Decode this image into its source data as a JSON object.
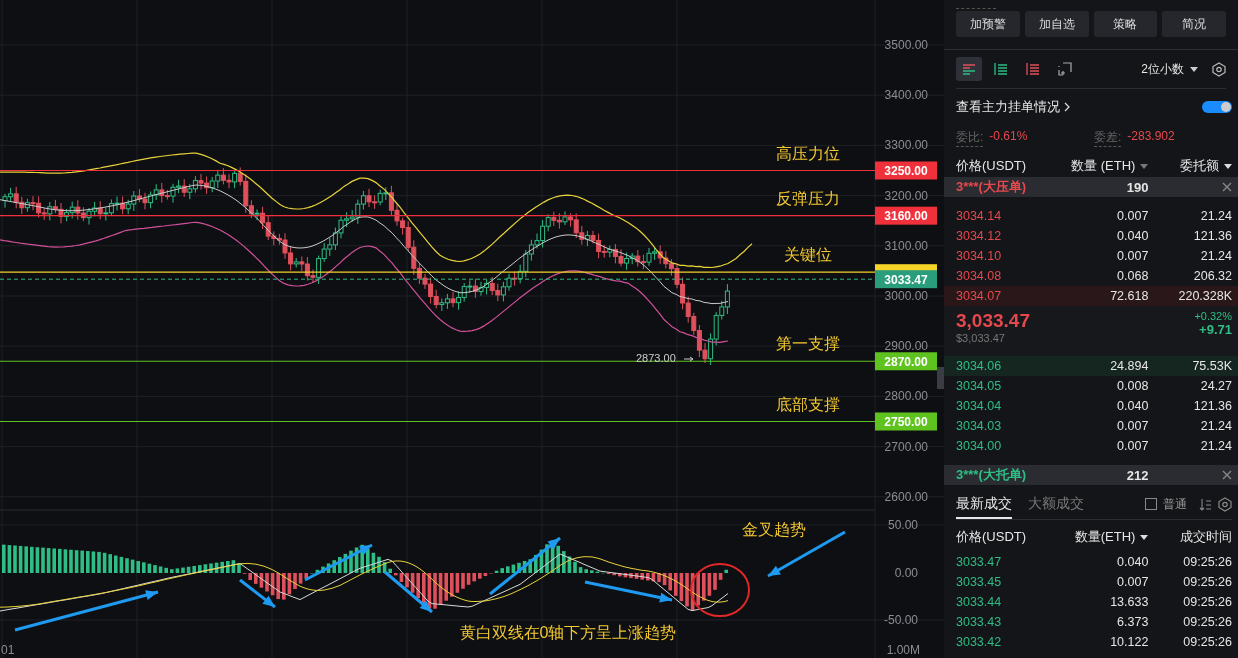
{
  "chart": {
    "price_ticks": [
      "3500.00",
      "3400.00",
      "3300.00",
      "3200.00",
      "3100.00",
      "3000.00",
      "2900.00",
      "2800.00",
      "2700.00",
      "2600.00"
    ],
    "levels": [
      {
        "price": "3250.00",
        "note": "高压力位",
        "color": "#f0313c"
      },
      {
        "price": "3160.00",
        "note": "反弹压力",
        "color": "#f0313c"
      },
      {
        "note": "关键位",
        "color": "#f5d327"
      },
      {
        "price": "2870.00",
        "note": "第一支撑",
        "color": "#5fc31f"
      },
      {
        "price": "2750.00",
        "note": "底部支撑",
        "color": "#5fc31f"
      }
    ],
    "current_price": "3033.47",
    "low_marker": "2873.00",
    "time_tick": "01"
  },
  "macd": {
    "ticks": [
      "50.00",
      "0.00",
      "-50.00"
    ],
    "volume_tick": "1.00M",
    "notes": [
      "金叉趋势",
      "黄白双线在0轴下方呈上涨趋势"
    ]
  },
  "panel": {
    "actions": [
      "加预警",
      "加自选",
      "策略",
      "简况"
    ],
    "depth_modes": [
      {
        "kind": "both",
        "selected": true
      },
      {
        "kind": "bids",
        "selected": false
      },
      {
        "kind": "asks",
        "selected": false
      },
      {
        "kind": "custom",
        "selected": false
      }
    ],
    "decimals": "2位小数",
    "main_orders": {
      "label": "查看主力挂单情况",
      "on": true
    },
    "stats": [
      {
        "label": "委比:",
        "value": "-0.61%"
      },
      {
        "label": "委差:",
        "value": "-283.902"
      }
    ],
    "book_columns": [
      {
        "label": "价格(USDT)",
        "caret": false
      },
      {
        "label": "数量 (ETH)",
        "caret": true
      },
      {
        "label": "委托额",
        "caret": true
      }
    ],
    "ask_banner": {
      "label": "3***(大压单)",
      "quantity": "190"
    },
    "asks": [
      {
        "price": "3034.14",
        "qty": "0.007",
        "amount": "21.24",
        "highlighted": false
      },
      {
        "price": "3034.12",
        "qty": "0.040",
        "amount": "121.36",
        "highlighted": false
      },
      {
        "price": "3034.10",
        "qty": "0.007",
        "amount": "21.24",
        "highlighted": false
      },
      {
        "price": "3034.08",
        "qty": "0.068",
        "amount": "206.32",
        "highlighted": false
      },
      {
        "price": "3034.07",
        "qty": "72.618",
        "amount": "220.328K",
        "highlighted": true
      }
    ],
    "last": {
      "price": "3,033.47",
      "usd": "$3,033.47",
      "change_pct": "+0.32%",
      "change": "+9.71"
    },
    "bids": [
      {
        "price": "3034.06",
        "qty": "24.894",
        "amount": "75.53K",
        "highlighted": true
      },
      {
        "price": "3034.05",
        "qty": "0.008",
        "amount": "24.27",
        "highlighted": false
      },
      {
        "price": "3034.04",
        "qty": "0.040",
        "amount": "121.36",
        "highlighted": false
      },
      {
        "price": "3034.03",
        "qty": "0.007",
        "amount": "21.24",
        "highlighted": false
      },
      {
        "price": "3034.00",
        "qty": "0.007",
        "amount": "21.24",
        "highlighted": false
      }
    ],
    "bid_banner": {
      "label": "3***(大托单)",
      "quantity": "212"
    },
    "trade_tabs": [
      {
        "label": "最新成交",
        "selected": true
      },
      {
        "label": "大额成交",
        "selected": false
      }
    ],
    "normal_filter": {
      "label": "普通",
      "checked": false
    },
    "trade_columns": [
      {
        "label": "价格(USDT)",
        "caret": false
      },
      {
        "label": "数量(ETH)",
        "caret": true
      },
      {
        "label": "成交时间",
        "caret": false
      }
    ],
    "trades": [
      {
        "price": "3033.47",
        "qty": "0.040",
        "time": "09:25:26"
      },
      {
        "price": "3033.45",
        "qty": "0.007",
        "time": "09:25:26"
      },
      {
        "price": "3033.44",
        "qty": "13.633",
        "time": "09:25:26"
      },
      {
        "price": "3033.43",
        "qty": "6.373",
        "time": "09:25:26"
      },
      {
        "price": "3033.42",
        "qty": "10.122",
        "time": "09:25:26"
      }
    ]
  }
}
